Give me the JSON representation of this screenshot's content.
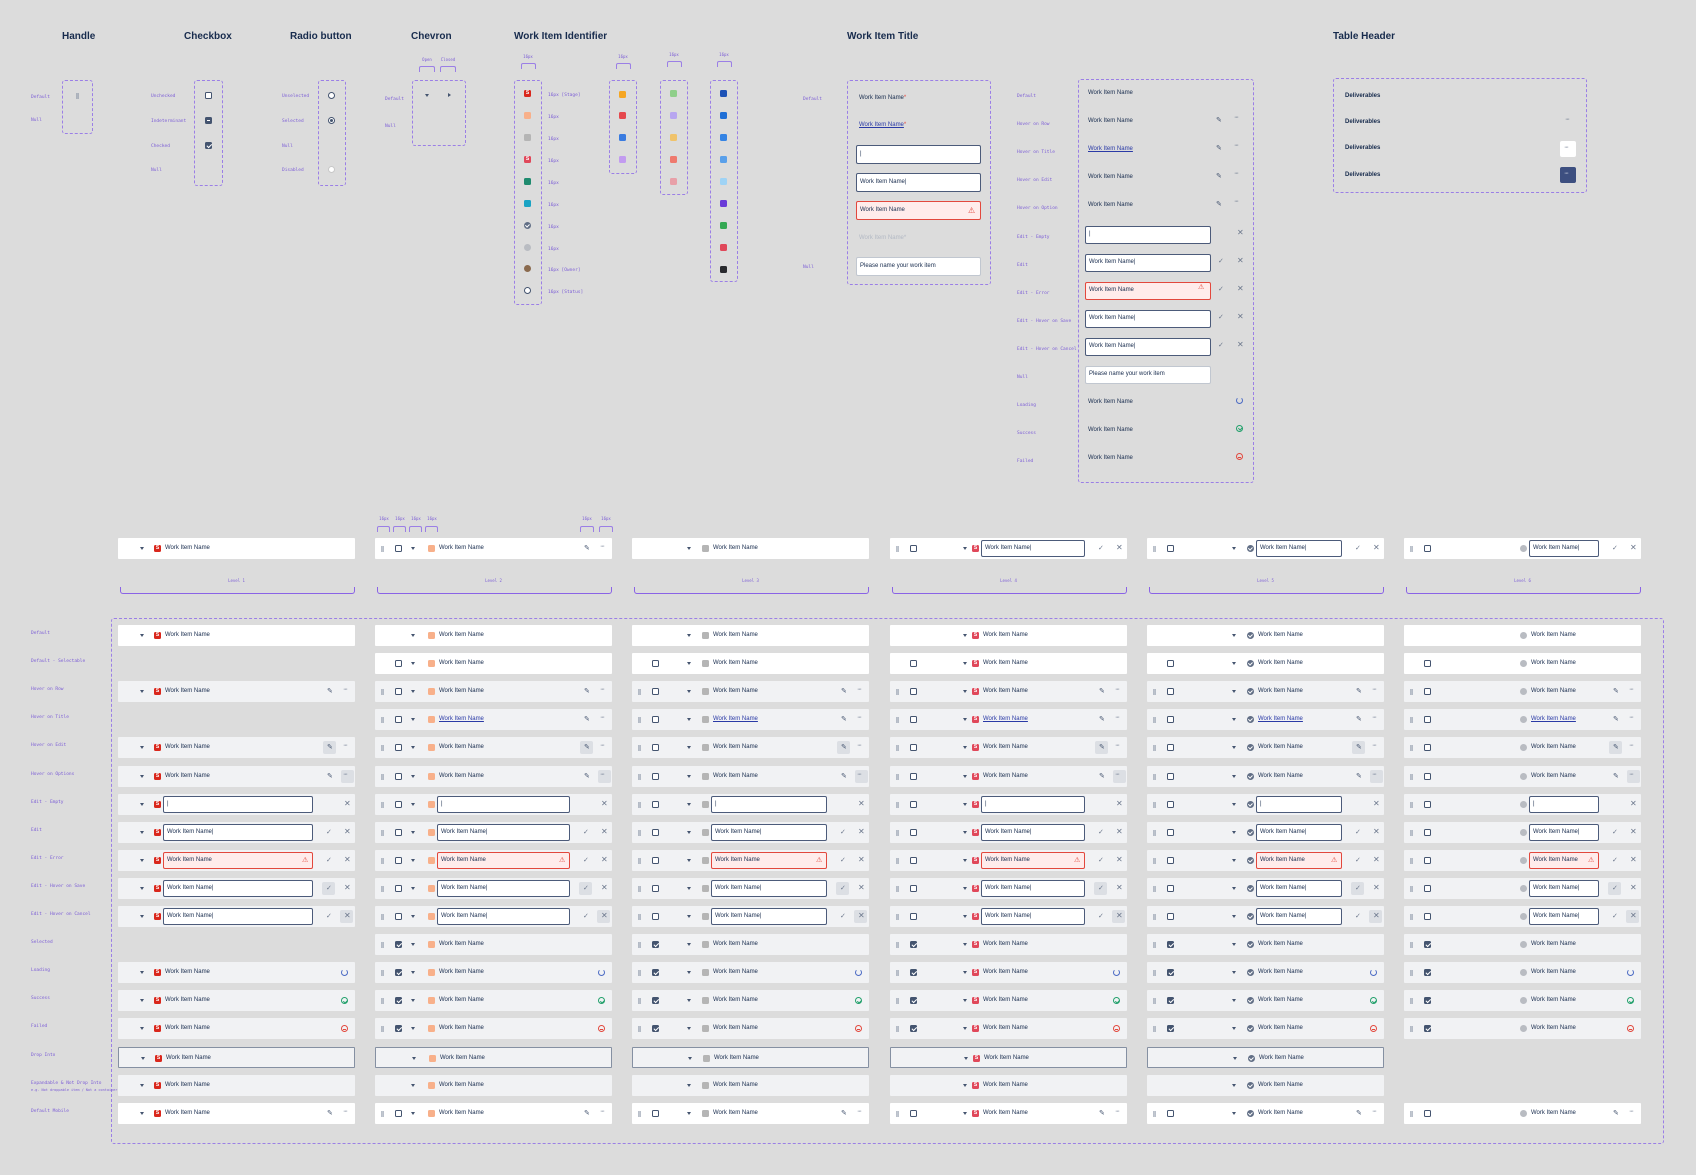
{
  "sections": {
    "handle": "Handle",
    "checkbox": "Checkbox",
    "radio": "Radio button",
    "chevron": "Chevron",
    "identifier": "Work Item Identifier",
    "title": "Work Item Title",
    "table_header": "Table Header"
  },
  "handle_states": [
    "Default",
    "Null"
  ],
  "checkbox_states": [
    "Unchecked",
    "Indeterminant",
    "Checked",
    "Null"
  ],
  "radio_states": [
    "Unselected",
    "Selected",
    "Null",
    "Disabled"
  ],
  "chevron": {
    "states": [
      "Default",
      "Null"
    ],
    "open": "Open",
    "closed": "Closed"
  },
  "identifier": {
    "col1_labels": [
      "16px [Stage]",
      "16px",
      "16px",
      "16px",
      "16px",
      "16px",
      "16px",
      "16px",
      "16px [Owner]",
      "16px [Status]"
    ],
    "widths": [
      "16px",
      "16px",
      "16px",
      "16px"
    ],
    "colors": [
      "#1d52b6",
      "#1f6fd6",
      "#3584e4",
      "#5aa0ea",
      "#9fd3f5",
      "#6a3bd8",
      "#34a853",
      "#e0485a",
      "#292a2e"
    ]
  },
  "title_left": {
    "states": [
      "Default",
      "Null"
    ],
    "item_name": "Work Item Name",
    "item_name_star": "*",
    "input_caret": "|",
    "input_value": "Work Item Name|",
    "placeholder": "Please name your work item"
  },
  "title_right": {
    "states": [
      "Default",
      "Hover on Row",
      "Hover on Title",
      "Hover on Edit",
      "Hover on Option",
      "Edit - Empty",
      "Edit",
      "Edit - Error",
      "Edit - Hover on Save",
      "Edit - Hover on Cancel",
      "Null",
      "Loading",
      "Success",
      "Failed"
    ]
  },
  "table_header": {
    "label": "Deliverables"
  },
  "levels": [
    "Level 1",
    "Level 2",
    "Level 3",
    "Level 4",
    "Level 5",
    "Level 6"
  ],
  "spacing_labels": {
    "s16": "16px"
  },
  "row_states": [
    "Default",
    "Default - Selectable",
    "Hover on Row",
    "Hover on Title",
    "Hover on Edit",
    "Hover on Options",
    "Edit - Empty",
    "Edit",
    "Edit - Error",
    "Edit - Hover on Save",
    "Edit - Hover on Cancel",
    "Selected",
    "Loading",
    "Success",
    "Failed",
    "Drop Into",
    "Expandable & Not Drop Into",
    "Default Mobile"
  ],
  "row_state_note": "e.g. Not droppable item / Not a container",
  "row": {
    "name": "Work Item Name",
    "name_cursor": "Work Item Name|",
    "caret": "|",
    "s_letter": "S",
    "r_letter": "S"
  },
  "glyphs": {
    "pencil": "✎",
    "dots": "···",
    "check": "✓",
    "close": "✕",
    "warn": "⚠"
  }
}
